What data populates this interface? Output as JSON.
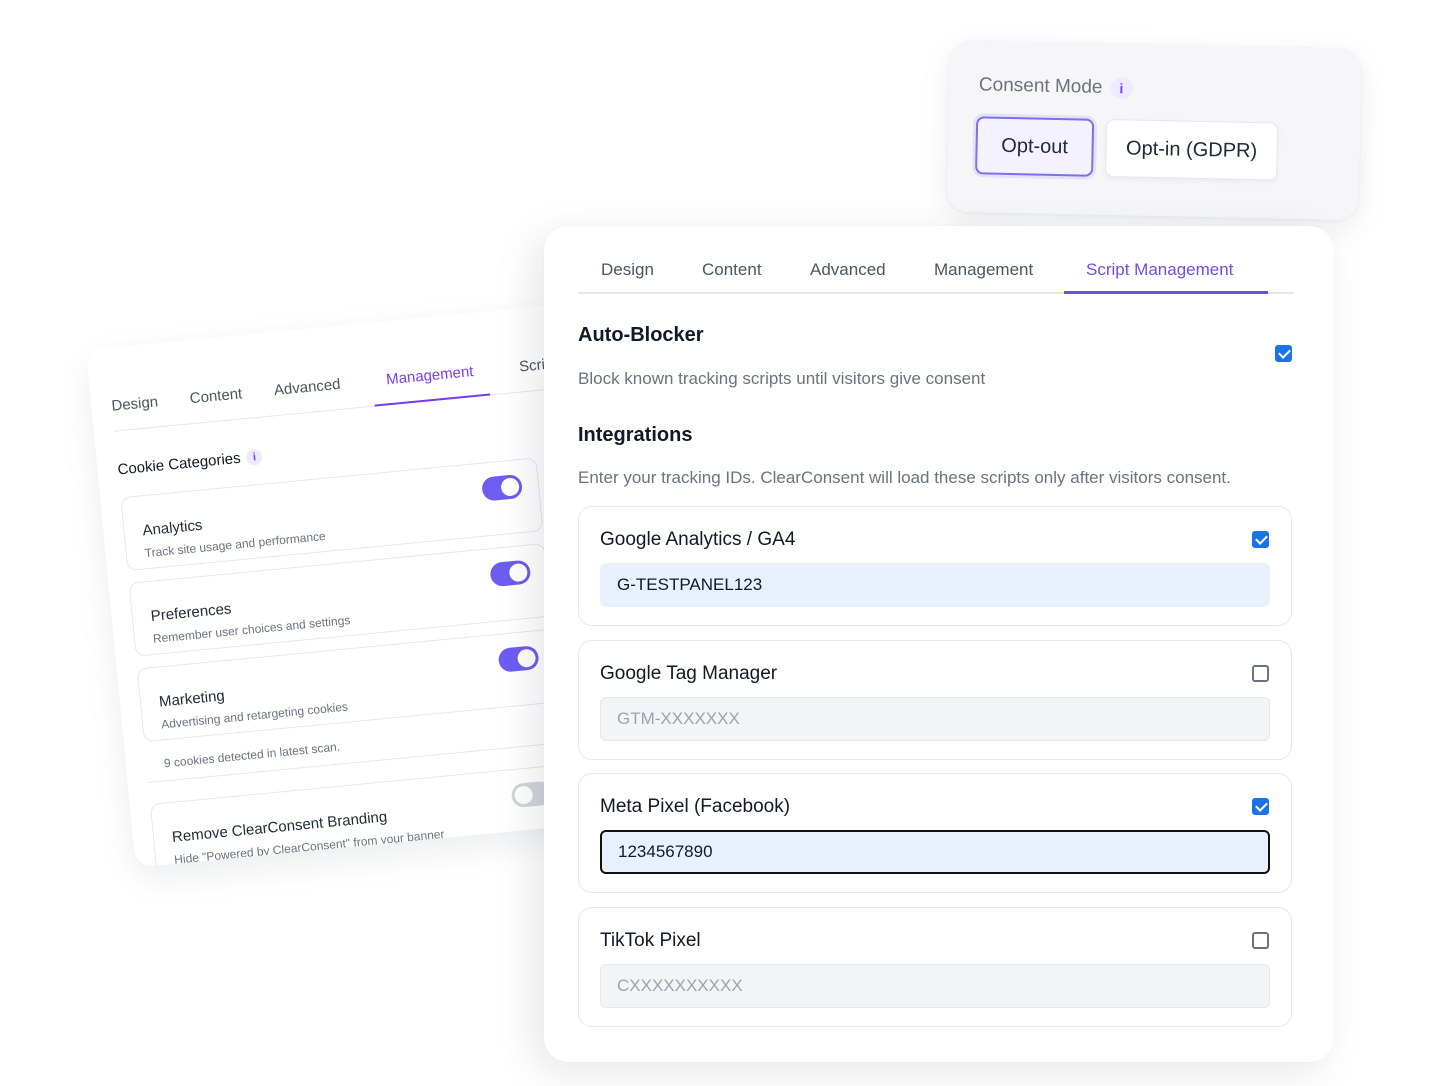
{
  "consent_mode": {
    "title": "Consent Mode",
    "info_icon": "i",
    "options": [
      "Opt-out",
      "Opt-in (GDPR)"
    ],
    "selected": "Opt-out"
  },
  "back_panel": {
    "tabs": [
      "Design",
      "Content",
      "Advanced",
      "Management",
      "Script Ma"
    ],
    "active_tab": "Management",
    "section_title": "Cookie Categories",
    "info_icon": "i",
    "categories": [
      {
        "title": "Analytics",
        "desc": "Track site usage and performance",
        "enabled": true
      },
      {
        "title": "Preferences",
        "desc": "Remember user choices and settings",
        "enabled": true
      },
      {
        "title": "Marketing",
        "desc": "Advertising and retargeting cookies",
        "enabled": true
      }
    ],
    "scan_text": "9 cookies detected in latest scan.",
    "branding": {
      "title": "Remove ClearConsent Branding",
      "desc": "Hide \"Powered by ClearConsent\" from your banner",
      "enabled": false
    }
  },
  "front_panel": {
    "tabs": [
      "Design",
      "Content",
      "Advanced",
      "Management",
      "Script Management"
    ],
    "active_tab": "Script Management",
    "auto_blocker": {
      "title": "Auto-Blocker",
      "desc": "Block known tracking scripts until visitors give consent",
      "checked": true
    },
    "integrations": {
      "title": "Integrations",
      "desc": "Enter your tracking IDs. ClearConsent will load these scripts only after visitors consent.",
      "items": [
        {
          "name": "Google Analytics / GA4",
          "checked": true,
          "value": "G-TESTPANEL123",
          "placeholder": ""
        },
        {
          "name": "Google Tag Manager",
          "checked": false,
          "value": "",
          "placeholder": "GTM-XXXXXXX"
        },
        {
          "name": "Meta Pixel (Facebook)",
          "checked": true,
          "value": "1234567890",
          "placeholder": ""
        },
        {
          "name": "TikTok Pixel",
          "checked": false,
          "value": "",
          "placeholder": "CXXXXXXXXXX"
        }
      ]
    }
  },
  "colors": {
    "accent": "#6d4ee0",
    "toggle_on": "#6d5df0",
    "checkbox": "#1a73e8",
    "filled_input": "#e8f0fe"
  }
}
